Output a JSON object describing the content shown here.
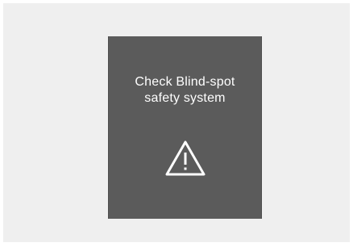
{
  "warning": {
    "message_line1": "Check Blind-spot",
    "message_line2": "safety system",
    "icon": "warning-triangle-icon",
    "sub_caption": ""
  },
  "colors": {
    "screen_background": "#5b5b5b",
    "text": "#ffffff",
    "outer_background": "#efefef"
  }
}
